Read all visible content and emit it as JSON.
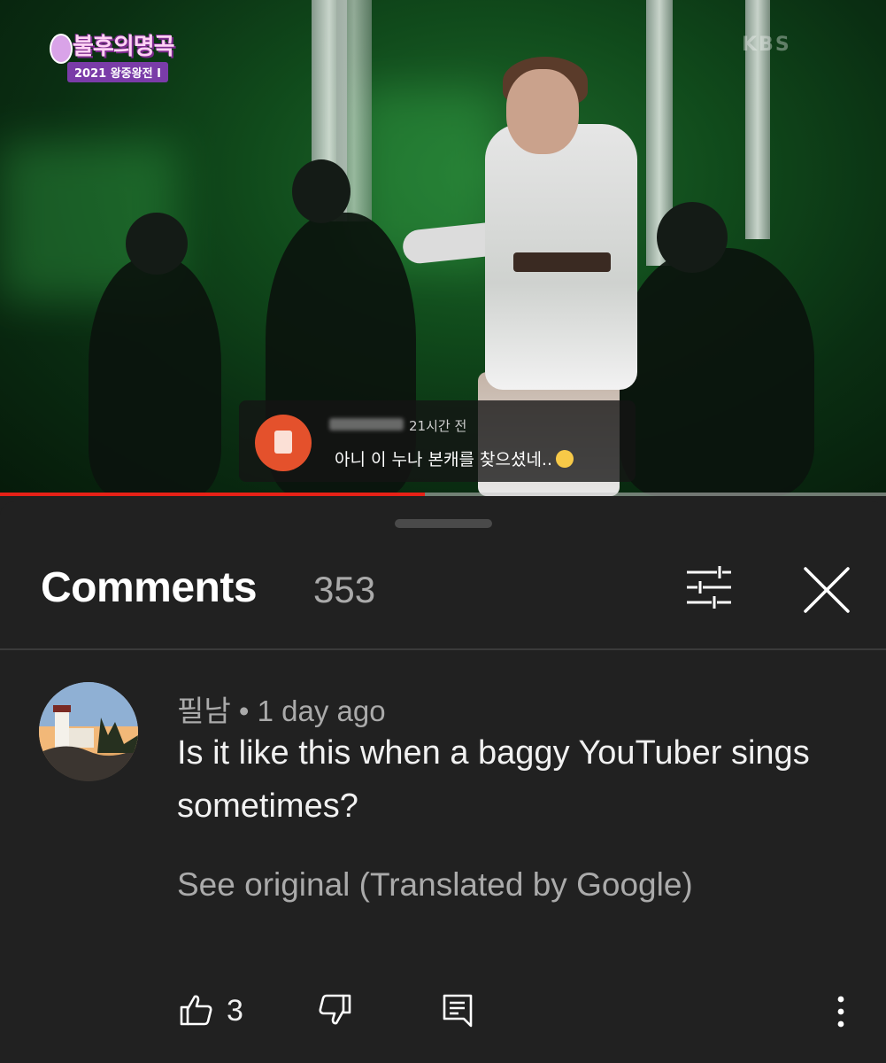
{
  "video": {
    "show_title": "불후의명곡",
    "show_subtitle": "2021 왕중왕전 I",
    "channel_mark": "KBS",
    "overlay_comment": {
      "time": "21시간 전",
      "text": "아니 이 누나 본캐를 찾으셨네.."
    },
    "progress": 0.48
  },
  "sheet": {
    "title": "Comments",
    "count": "353"
  },
  "comment": {
    "author": "필남",
    "separator": "•",
    "time": "1 day ago",
    "text": "Is it like this when a baggy YouTuber sings sometimes?",
    "see_original": "See original (Translated by Google)",
    "likes": "3"
  },
  "colors": {
    "background": "#212121",
    "progress": "#e62117",
    "secondary_text": "#aaaaaa",
    "primary_text": "#f1f1f1"
  },
  "icons": {
    "filter": "sliders-icon",
    "close": "close-icon",
    "like": "thumbs-up-icon",
    "dislike": "thumbs-down-icon",
    "reply": "reply-comment-icon",
    "more": "more-vertical-icon"
  }
}
